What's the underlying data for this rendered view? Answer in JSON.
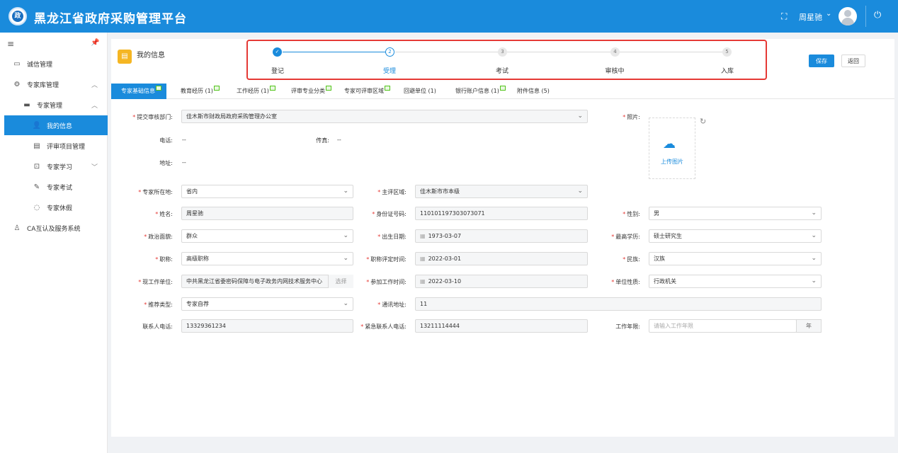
{
  "header": {
    "app_title": "黑龙江省政府采购管理平台",
    "logo_text": "政",
    "username": "周星驰",
    "fullscreen_icon": "fullscreen-icon",
    "power_icon": "power-icon"
  },
  "sidebar": {
    "items": [
      {
        "label": "诚信管理",
        "icon": "credit-icon"
      },
      {
        "label": "专家库管理",
        "icon": "gear-icon"
      },
      {
        "label": "专家管理",
        "icon": "monitor-icon"
      },
      {
        "label": "我的信息",
        "icon": "user-icon"
      },
      {
        "label": "评审项目管理",
        "icon": "calendar-icon"
      },
      {
        "label": "专家学习",
        "icon": "book-icon"
      },
      {
        "label": "专家考试",
        "icon": "exam-icon"
      },
      {
        "label": "专家休假",
        "icon": "leave-icon"
      },
      {
        "label": "CA互认及服务系统",
        "icon": "ca-icon"
      }
    ]
  },
  "page": {
    "title": "我的信息",
    "save_label": "保存",
    "back_label": "返回"
  },
  "steps": [
    {
      "num": "✓",
      "label": "登记",
      "state": "done"
    },
    {
      "num": "2",
      "label": "受理",
      "state": "active"
    },
    {
      "num": "3",
      "label": "考试",
      "state": "pending"
    },
    {
      "num": "4",
      "label": "审核中",
      "state": "pending"
    },
    {
      "num": "5",
      "label": "入库",
      "state": "pending"
    }
  ],
  "tabs": [
    "专家基础信息",
    "教育经历 (1)",
    "工作经历 (1)",
    "评审专业分类",
    "专家可评审区域",
    "回避单位 (1)",
    "银行账户信息 (1)",
    "附件信息 (5)"
  ],
  "form": {
    "dept_label": "提交审核部门:",
    "dept_value": "佳木斯市财政局政府采购管理办公室",
    "phone_label": "电话:",
    "phone_value": "--",
    "fax_label": "传真:",
    "fax_value": "--",
    "addr_label": "地址:",
    "addr_value": "--",
    "photo_label": "照片:",
    "upload_label": "上传图片",
    "location_label": "专家所在地:",
    "location_value": "省内",
    "area_label": "主评区域:",
    "area_value": "佳木斯市市本级",
    "name_label": "姓名:",
    "name_value": "周星驰",
    "id_label": "身份证号码:",
    "id_value": "110101197303073071",
    "gender_label": "性别:",
    "gender_value": "男",
    "politic_label": "政治面貌:",
    "politic_value": "群众",
    "birth_label": "出生日期:",
    "birth_value": "1973-03-07",
    "edu_label": "最高学历:",
    "edu_value": "硕士研究生",
    "title_label": "职称:",
    "title_value": "高级职称",
    "title_date_label": "职称评定时间:",
    "title_date_value": "2022-03-01",
    "nation_label": "民族:",
    "nation_value": "汉族",
    "employer_label": "现工作单位:",
    "employer_value": "中共黑龙江省委密码保障与电子政务内网技术服务中心",
    "select_label": "选择",
    "work_start_label": "参加工作时间:",
    "work_start_value": "2022-03-10",
    "unit_nature_label": "单位性质:",
    "unit_nature_value": "行政机关",
    "recommend_label": "推荐类型:",
    "recommend_value": "专家自荐",
    "mail_label": "通讯地址:",
    "mail_value": "11",
    "contact_label": "联系人电话:",
    "contact_value": "13329361234",
    "emergency_label": "紧急联系人电话:",
    "emergency_value": "13211114444",
    "years_label": "工作年限:",
    "years_placeholder": "请输入工作年限",
    "years_unit": "年"
  },
  "colors": {
    "brand": "#1a8bdc",
    "highlight_border": "#e53935",
    "required": "#e53935"
  }
}
